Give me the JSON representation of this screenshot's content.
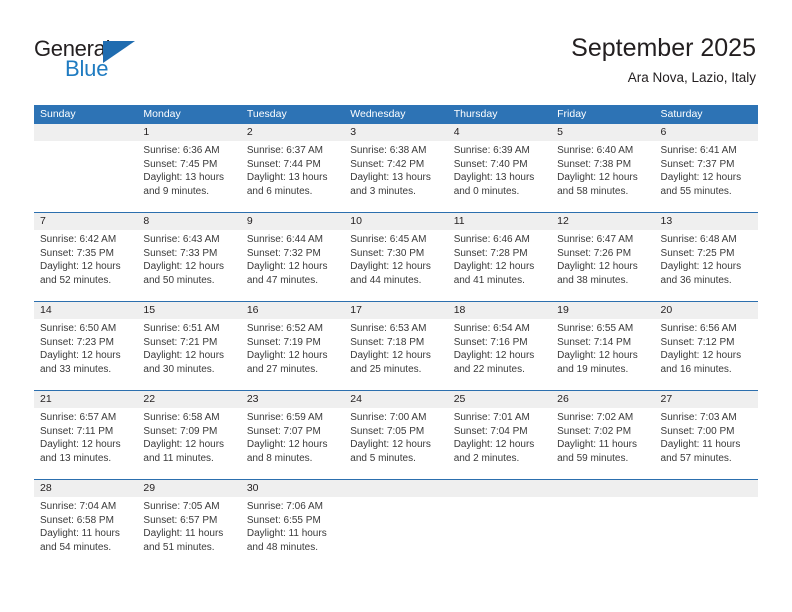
{
  "brand": {
    "name_part1": "General",
    "name_part2": "Blue",
    "triangle_color": "#1f6cb0",
    "blue_color": "#1f7bc1"
  },
  "header": {
    "title": "September 2025",
    "subtitle": "Ara Nova, Lazio, Italy"
  },
  "theme": {
    "header_band": "#2d73b5",
    "week_rule": "#2c6fae",
    "daynum_strip": "#efefef",
    "text": "#231f20"
  },
  "weekdays": [
    "Sunday",
    "Monday",
    "Tuesday",
    "Wednesday",
    "Thursday",
    "Friday",
    "Saturday"
  ],
  "weeks": [
    {
      "daynums": [
        "",
        "1",
        "2",
        "3",
        "4",
        "5",
        "6"
      ],
      "cells": [
        {
          "lines": []
        },
        {
          "lines": [
            "Sunrise: 6:36 AM",
            "Sunset: 7:45 PM",
            "Daylight: 13 hours",
            "and 9 minutes."
          ]
        },
        {
          "lines": [
            "Sunrise: 6:37 AM",
            "Sunset: 7:44 PM",
            "Daylight: 13 hours",
            "and 6 minutes."
          ]
        },
        {
          "lines": [
            "Sunrise: 6:38 AM",
            "Sunset: 7:42 PM",
            "Daylight: 13 hours",
            "and 3 minutes."
          ]
        },
        {
          "lines": [
            "Sunrise: 6:39 AM",
            "Sunset: 7:40 PM",
            "Daylight: 13 hours",
            "and 0 minutes."
          ]
        },
        {
          "lines": [
            "Sunrise: 6:40 AM",
            "Sunset: 7:38 PM",
            "Daylight: 12 hours",
            "and 58 minutes."
          ]
        },
        {
          "lines": [
            "Sunrise: 6:41 AM",
            "Sunset: 7:37 PM",
            "Daylight: 12 hours",
            "and 55 minutes."
          ]
        }
      ]
    },
    {
      "daynums": [
        "7",
        "8",
        "9",
        "10",
        "11",
        "12",
        "13"
      ],
      "cells": [
        {
          "lines": [
            "Sunrise: 6:42 AM",
            "Sunset: 7:35 PM",
            "Daylight: 12 hours",
            "and 52 minutes."
          ]
        },
        {
          "lines": [
            "Sunrise: 6:43 AM",
            "Sunset: 7:33 PM",
            "Daylight: 12 hours",
            "and 50 minutes."
          ]
        },
        {
          "lines": [
            "Sunrise: 6:44 AM",
            "Sunset: 7:32 PM",
            "Daylight: 12 hours",
            "and 47 minutes."
          ]
        },
        {
          "lines": [
            "Sunrise: 6:45 AM",
            "Sunset: 7:30 PM",
            "Daylight: 12 hours",
            "and 44 minutes."
          ]
        },
        {
          "lines": [
            "Sunrise: 6:46 AM",
            "Sunset: 7:28 PM",
            "Daylight: 12 hours",
            "and 41 minutes."
          ]
        },
        {
          "lines": [
            "Sunrise: 6:47 AM",
            "Sunset: 7:26 PM",
            "Daylight: 12 hours",
            "and 38 minutes."
          ]
        },
        {
          "lines": [
            "Sunrise: 6:48 AM",
            "Sunset: 7:25 PM",
            "Daylight: 12 hours",
            "and 36 minutes."
          ]
        }
      ]
    },
    {
      "daynums": [
        "14",
        "15",
        "16",
        "17",
        "18",
        "19",
        "20"
      ],
      "cells": [
        {
          "lines": [
            "Sunrise: 6:50 AM",
            "Sunset: 7:23 PM",
            "Daylight: 12 hours",
            "and 33 minutes."
          ]
        },
        {
          "lines": [
            "Sunrise: 6:51 AM",
            "Sunset: 7:21 PM",
            "Daylight: 12 hours",
            "and 30 minutes."
          ]
        },
        {
          "lines": [
            "Sunrise: 6:52 AM",
            "Sunset: 7:19 PM",
            "Daylight: 12 hours",
            "and 27 minutes."
          ]
        },
        {
          "lines": [
            "Sunrise: 6:53 AM",
            "Sunset: 7:18 PM",
            "Daylight: 12 hours",
            "and 25 minutes."
          ]
        },
        {
          "lines": [
            "Sunrise: 6:54 AM",
            "Sunset: 7:16 PM",
            "Daylight: 12 hours",
            "and 22 minutes."
          ]
        },
        {
          "lines": [
            "Sunrise: 6:55 AM",
            "Sunset: 7:14 PM",
            "Daylight: 12 hours",
            "and 19 minutes."
          ]
        },
        {
          "lines": [
            "Sunrise: 6:56 AM",
            "Sunset: 7:12 PM",
            "Daylight: 12 hours",
            "and 16 minutes."
          ]
        }
      ]
    },
    {
      "daynums": [
        "21",
        "22",
        "23",
        "24",
        "25",
        "26",
        "27"
      ],
      "cells": [
        {
          "lines": [
            "Sunrise: 6:57 AM",
            "Sunset: 7:11 PM",
            "Daylight: 12 hours",
            "and 13 minutes."
          ]
        },
        {
          "lines": [
            "Sunrise: 6:58 AM",
            "Sunset: 7:09 PM",
            "Daylight: 12 hours",
            "and 11 minutes."
          ]
        },
        {
          "lines": [
            "Sunrise: 6:59 AM",
            "Sunset: 7:07 PM",
            "Daylight: 12 hours",
            "and 8 minutes."
          ]
        },
        {
          "lines": [
            "Sunrise: 7:00 AM",
            "Sunset: 7:05 PM",
            "Daylight: 12 hours",
            "and 5 minutes."
          ]
        },
        {
          "lines": [
            "Sunrise: 7:01 AM",
            "Sunset: 7:04 PM",
            "Daylight: 12 hours",
            "and 2 minutes."
          ]
        },
        {
          "lines": [
            "Sunrise: 7:02 AM",
            "Sunset: 7:02 PM",
            "Daylight: 11 hours",
            "and 59 minutes."
          ]
        },
        {
          "lines": [
            "Sunrise: 7:03 AM",
            "Sunset: 7:00 PM",
            "Daylight: 11 hours",
            "and 57 minutes."
          ]
        }
      ]
    },
    {
      "daynums": [
        "28",
        "29",
        "30",
        "",
        "",
        "",
        ""
      ],
      "cells": [
        {
          "lines": [
            "Sunrise: 7:04 AM",
            "Sunset: 6:58 PM",
            "Daylight: 11 hours",
            "and 54 minutes."
          ]
        },
        {
          "lines": [
            "Sunrise: 7:05 AM",
            "Sunset: 6:57 PM",
            "Daylight: 11 hours",
            "and 51 minutes."
          ]
        },
        {
          "lines": [
            "Sunrise: 7:06 AM",
            "Sunset: 6:55 PM",
            "Daylight: 11 hours",
            "and 48 minutes."
          ]
        },
        {
          "lines": []
        },
        {
          "lines": []
        },
        {
          "lines": []
        },
        {
          "lines": []
        }
      ]
    }
  ]
}
